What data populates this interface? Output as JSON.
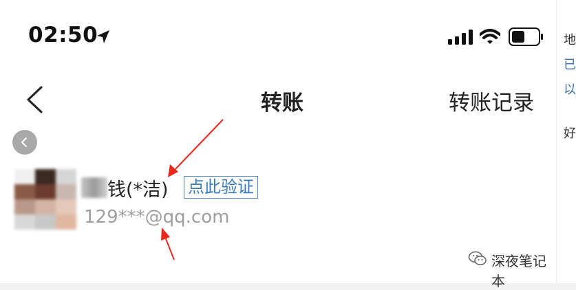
{
  "status_bar": {
    "time": "02:50"
  },
  "nav": {
    "title": "转账",
    "right_action": "转账记录"
  },
  "recipient": {
    "name": "钱(*洁)",
    "verify_label": "点此验证",
    "account": "129***@qq.com"
  },
  "watermark": {
    "text": "深夜笔记本"
  },
  "right_strip": {
    "chars": [
      "地",
      "已",
      "以",
      "好"
    ]
  },
  "colors": {
    "verify_blue": "#3a7bc0",
    "arrow_red": "#e8281c",
    "account_gray": "#9e9e9e"
  },
  "icons": [
    "location-arrow-icon",
    "signal-icon",
    "wifi-icon",
    "battery-icon",
    "back-chevron-icon",
    "floating-back-icon",
    "wechat-icon"
  ]
}
